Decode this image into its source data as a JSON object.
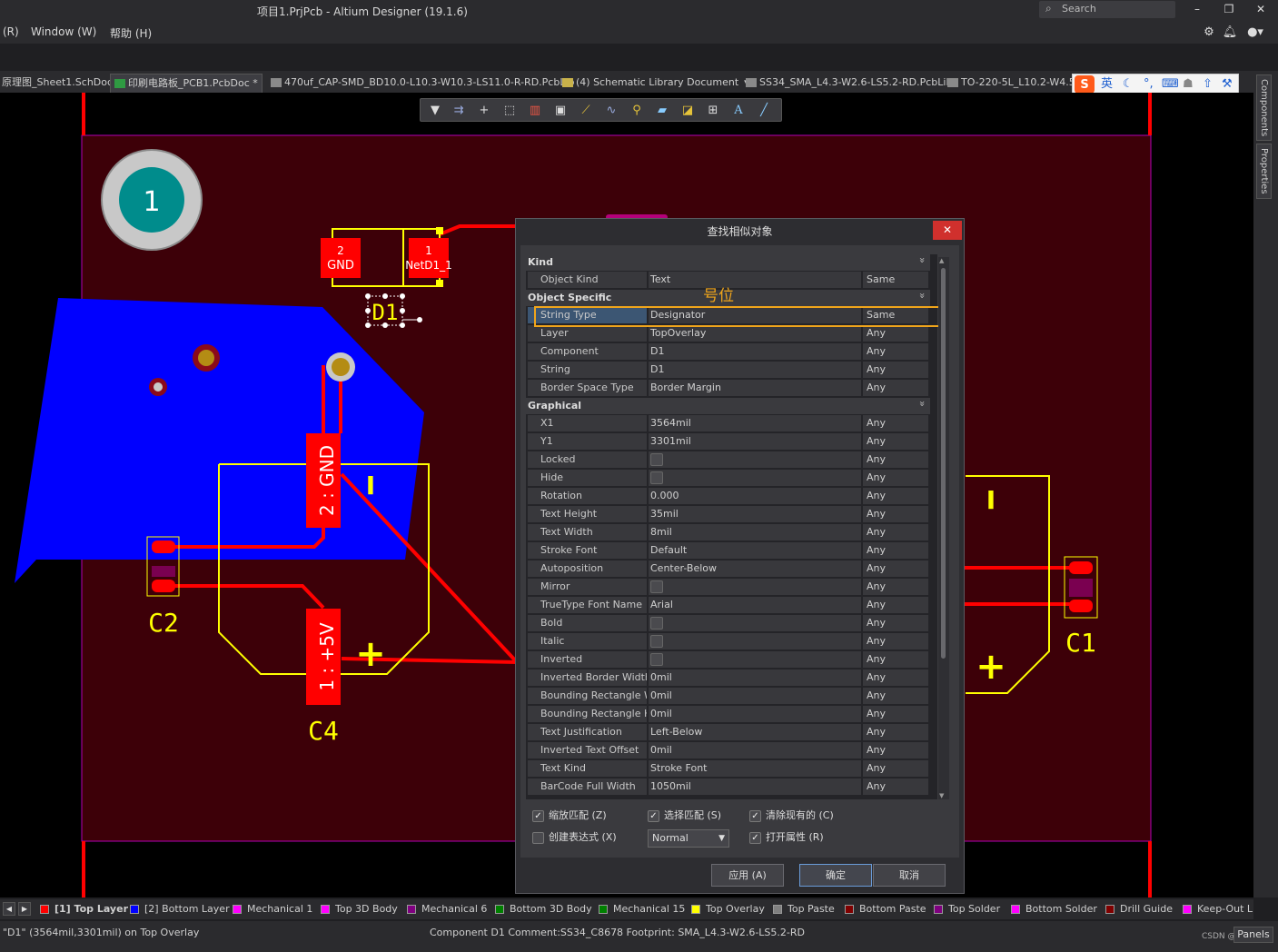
{
  "app": {
    "title": "项目1.PrjPcb - Altium Designer (19.1.6)",
    "search_placeholder": "Search"
  },
  "window_controls": {
    "minimize": "–",
    "restore": "❐",
    "close": "✕"
  },
  "menu": {
    "items": [
      "(R)",
      "Window (W)",
      "帮助 (H)"
    ]
  },
  "doc_tabs": [
    "原理图_Sheet1.SchDoc",
    "印刷电路板_PCB1.PcbDoc *",
    "470uf_CAP-SMD_BD10.0-L10.3-W10.3-LS11.0-R-RD.PcbLib",
    "(4) Schematic Library Document",
    "SS34_SMA_L4.3-W2.6-LS5.2-RD.PcbLib",
    "TO-220-5L_L10.2-W4.5-P"
  ],
  "ime": {
    "logo": "S",
    "lang": "英"
  },
  "right_panels": [
    "Components",
    "Properties"
  ],
  "pcb": {
    "hole_label": "1",
    "pad_gnd_num": "2",
    "pad_gnd_net": "GND",
    "pad_net_num": "1",
    "pad_net_name": "NetD1_1",
    "d1": "D1",
    "pad_c4_gnd": "2 : GND",
    "pad_c4_5v": "1 : +5V",
    "c2": "C2",
    "c4": "C4",
    "c1": "C1",
    "bar": "I",
    "plus": "+"
  },
  "dialog": {
    "title": "查找相似对象",
    "close": "✕",
    "note": "号位",
    "categories": [
      {
        "name": "Kind",
        "rows": [
          {
            "label": "Object Kind",
            "value": "Text",
            "match": "Same"
          }
        ]
      },
      {
        "name": "Object Specific",
        "rows": [
          {
            "label": "String Type",
            "value": "Designator",
            "match": "Same"
          },
          {
            "label": "Layer",
            "value": "TopOverlay",
            "match": "Any"
          },
          {
            "label": "Component",
            "value": "D1",
            "match": "Any"
          },
          {
            "label": "String",
            "value": "D1",
            "match": "Any"
          },
          {
            "label": "Border Space Type",
            "value": "Border Margin",
            "match": "Any"
          }
        ]
      },
      {
        "name": "Graphical",
        "rows": [
          {
            "label": "X1",
            "value": "3564mil",
            "match": "Any"
          },
          {
            "label": "Y1",
            "value": "3301mil",
            "match": "Any"
          },
          {
            "label": "Locked",
            "value": "",
            "match": "Any"
          },
          {
            "label": "Hide",
            "value": "",
            "match": "Any"
          },
          {
            "label": "Rotation",
            "value": "0.000",
            "match": "Any"
          },
          {
            "label": "Text Height",
            "value": "35mil",
            "match": "Any"
          },
          {
            "label": "Text Width",
            "value": "8mil",
            "match": "Any"
          },
          {
            "label": "Stroke Font",
            "value": "Default",
            "match": "Any"
          },
          {
            "label": "Autoposition",
            "value": "Center-Below",
            "match": "Any"
          },
          {
            "label": "Mirror",
            "value": "",
            "match": "Any"
          },
          {
            "label": "TrueType Font Name",
            "value": "Arial",
            "match": "Any"
          },
          {
            "label": "Bold",
            "value": "",
            "match": "Any"
          },
          {
            "label": "Italic",
            "value": "",
            "match": "Any"
          },
          {
            "label": "Inverted",
            "value": "",
            "match": "Any"
          },
          {
            "label": "Inverted Border Width",
            "value": "0mil",
            "match": "Any"
          },
          {
            "label": "Bounding Rectangle W",
            "value": "0mil",
            "match": "Any"
          },
          {
            "label": "Bounding Rectangle H",
            "value": "0mil",
            "match": "Any"
          },
          {
            "label": "Text Justification",
            "value": "Left-Below",
            "match": "Any"
          },
          {
            "label": "Inverted Text Offset",
            "value": "0mil",
            "match": "Any"
          },
          {
            "label": "Text Kind",
            "value": "Stroke Font",
            "match": "Any"
          },
          {
            "label": "BarCode Full Width",
            "value": "1050mil",
            "match": "Any"
          }
        ]
      }
    ],
    "checkbox_fields": [
      "Locked",
      "Hide",
      "Mirror",
      "Bold",
      "Italic",
      "Inverted"
    ],
    "options": {
      "zoom_match": {
        "label": "缩放匹配 (Z)",
        "checked": true
      },
      "select_match": {
        "label": "选择匹配 (S)",
        "checked": true
      },
      "clear_existing": {
        "label": "清除现有的 (C)",
        "checked": true
      },
      "create_expression": {
        "label": "创建表达式 (X)",
        "checked": false
      },
      "open_properties": {
        "label": "打开属性 (R)",
        "checked": true
      },
      "mode": "Normal"
    },
    "buttons": {
      "apply": "应用 (A)",
      "ok": "确定",
      "cancel": "取消"
    }
  },
  "layers": [
    {
      "name": "[1] Top Layer",
      "color": "#ff0000",
      "active": true
    },
    {
      "name": "[2] Bottom Layer",
      "color": "#0000ff"
    },
    {
      "name": "Mechanical 1",
      "color": "#ff00ff"
    },
    {
      "name": "Top 3D Body",
      "color": "#ff00ff"
    },
    {
      "name": "Mechanical 6",
      "color": "#800080"
    },
    {
      "name": "Bottom 3D Body",
      "color": "#008000"
    },
    {
      "name": "Mechanical 15",
      "color": "#008000"
    },
    {
      "name": "Top Overlay",
      "color": "#ffff00"
    },
    {
      "name": "Top Paste",
      "color": "#808080"
    },
    {
      "name": "Bottom Paste",
      "color": "#800000"
    },
    {
      "name": "Top Solder",
      "color": "#800080"
    },
    {
      "name": "Bottom Solder",
      "color": "#ff00ff"
    },
    {
      "name": "Drill Guide",
      "color": "#800000"
    },
    {
      "name": "Keep-Out L",
      "color": "#ff00ff"
    }
  ],
  "status": {
    "left": "\"D1\" (3564mil,3301mil) on Top Overlay",
    "component": "Component D1 Comment:SS34_C8678 Footprint: SMA_L4.3-W2.6-LS5.2-RD",
    "watermark": "CSDN @hilllllu",
    "panels": "Panels"
  },
  "colors": {
    "board": "#3d0008",
    "copper_top": "#ff0000",
    "copper_bottom": "#0000ff",
    "overlay": "#ffff00",
    "highlight": "#f0a51b"
  }
}
